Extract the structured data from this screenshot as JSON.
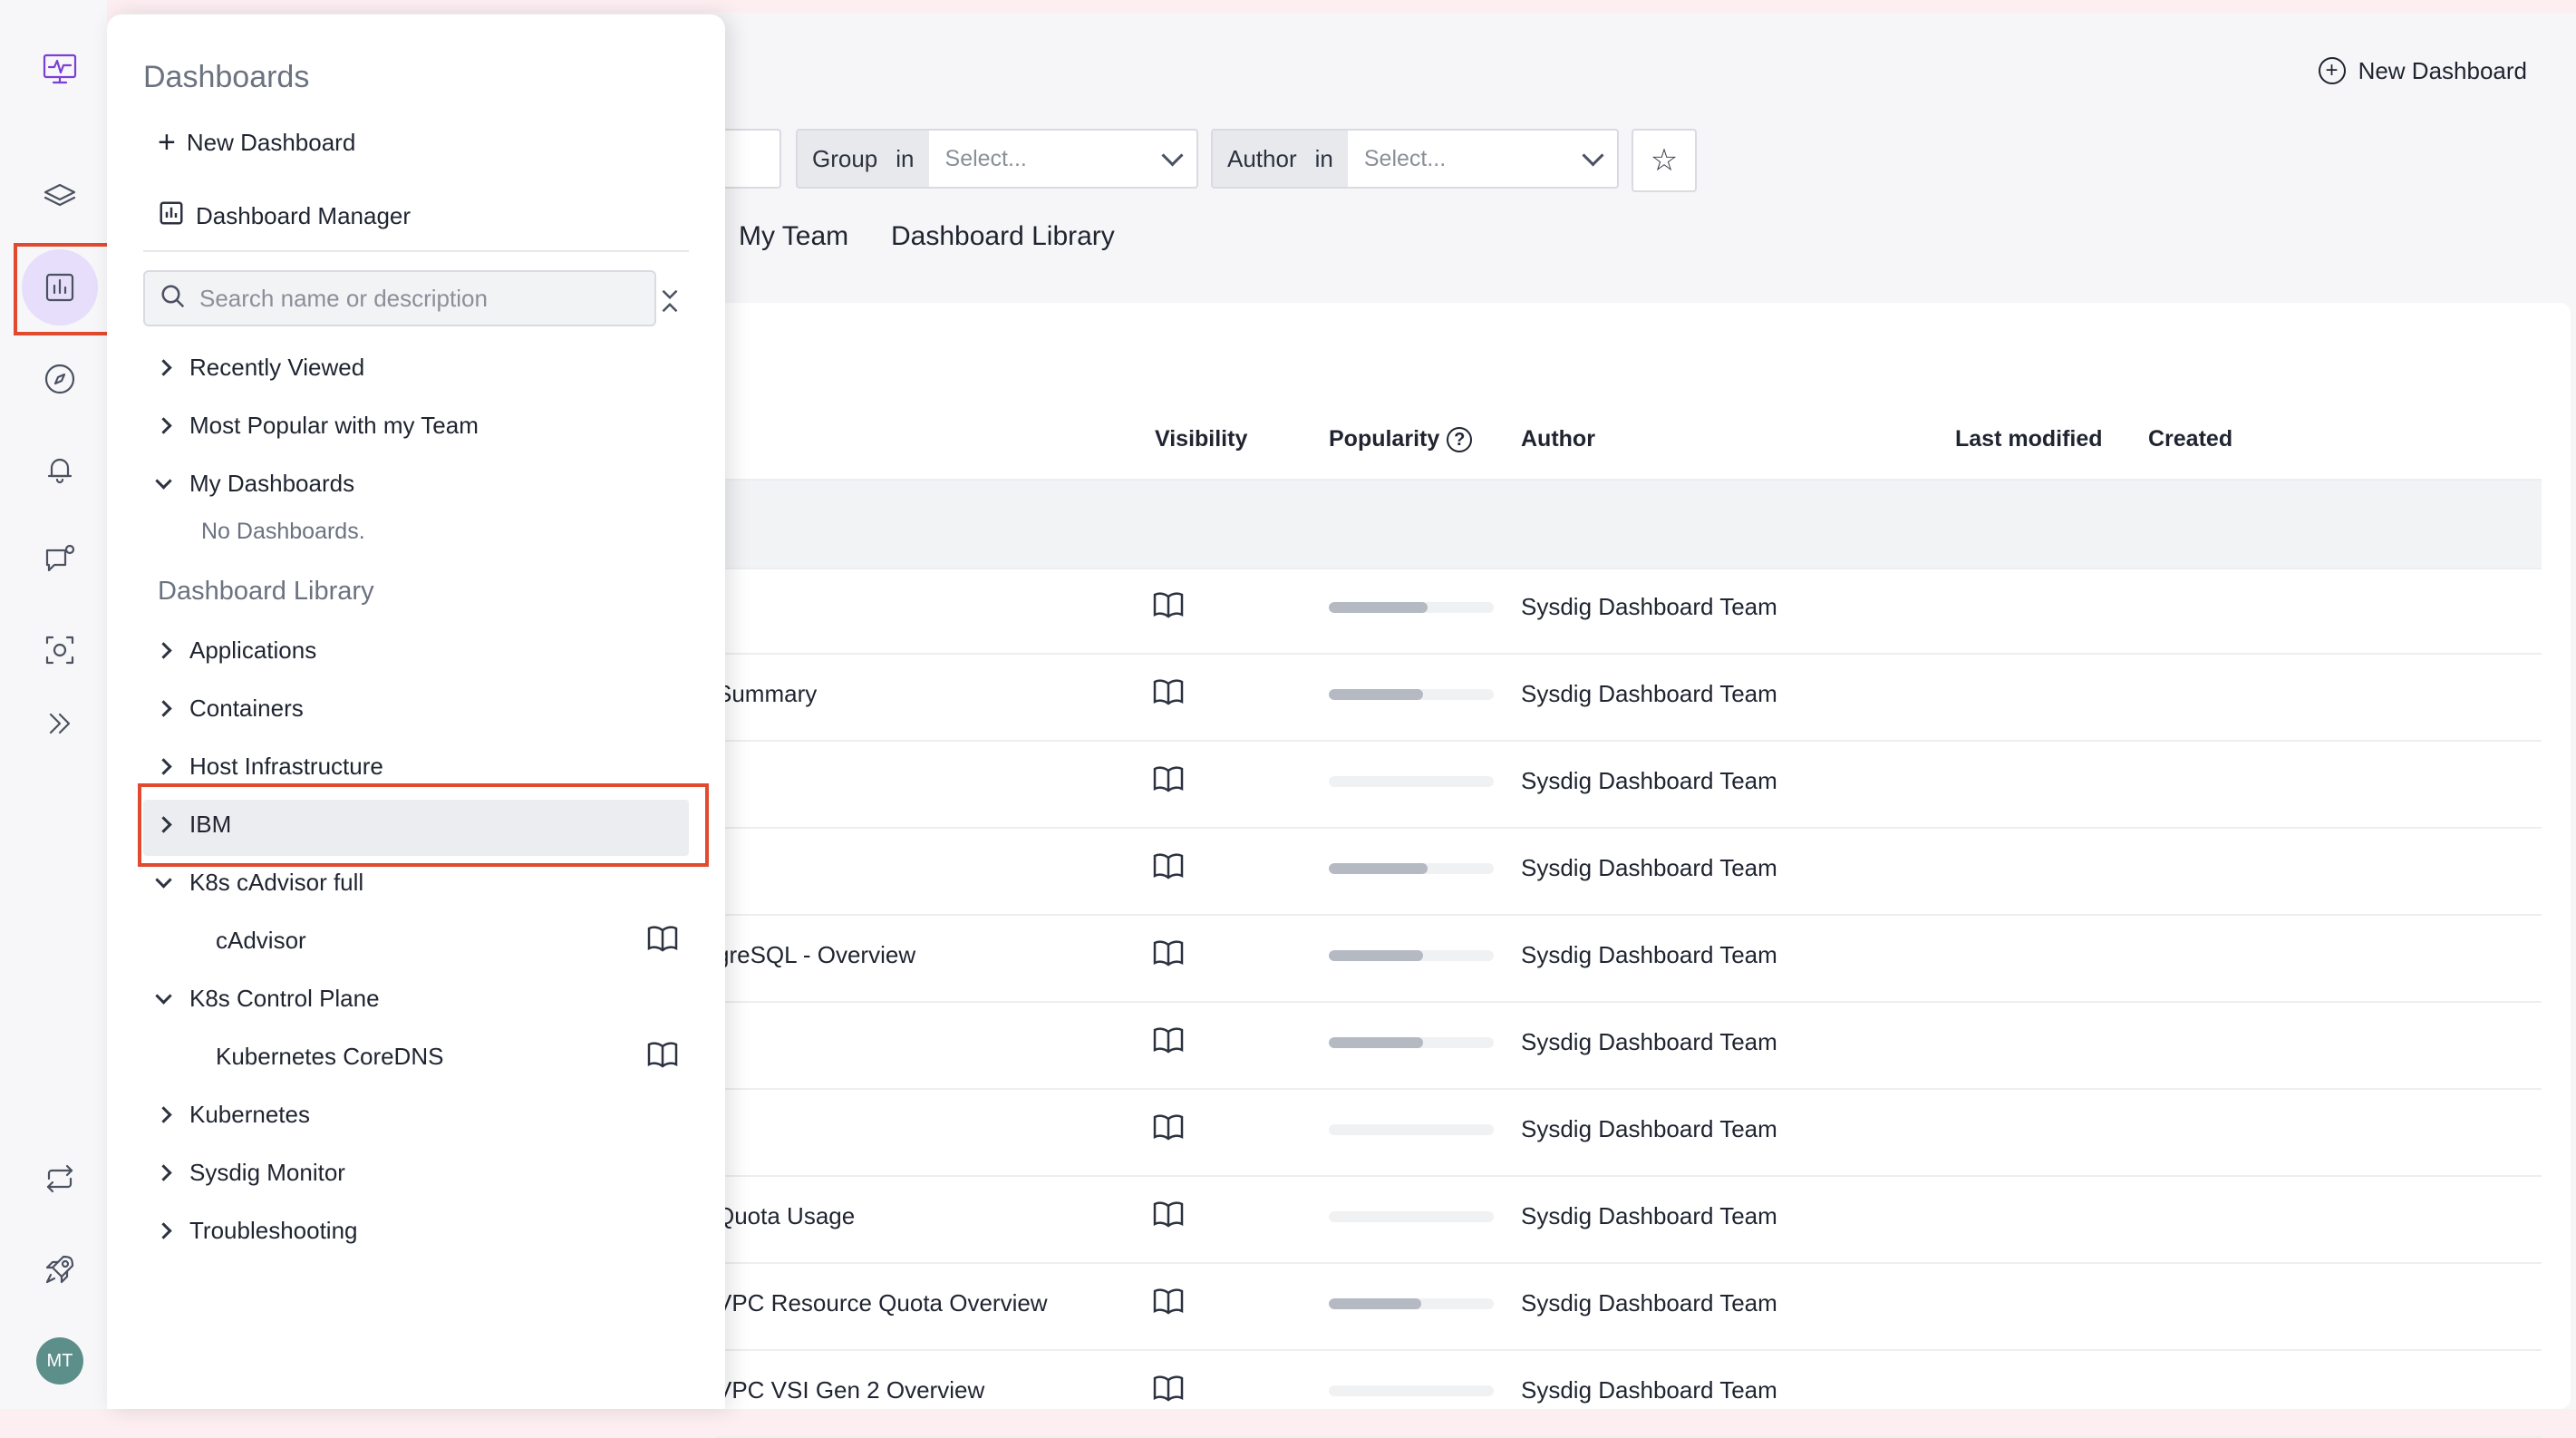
{
  "header": {
    "new_dashboard_label": "New Dashboard"
  },
  "filters": {
    "group": {
      "label": "Group",
      "op": "in",
      "placeholder": "Select..."
    },
    "author": {
      "label": "Author",
      "op": "in",
      "placeholder": "Select..."
    }
  },
  "tabs": [
    "My Team",
    "Dashboard Library"
  ],
  "table": {
    "columns": {
      "visibility": "Visibility",
      "popularity": "Popularity",
      "author": "Author",
      "last_modified": "Last modified",
      "created": "Created"
    },
    "rows": [
      {
        "name": "",
        "popularity": 0.6,
        "author": "Sysdig Dashboard Team"
      },
      {
        "name": "Summary",
        "popularity": 0.57,
        "author": "Sysdig Dashboard Team"
      },
      {
        "name": "",
        "popularity": 0.0,
        "author": "Sysdig Dashboard Team"
      },
      {
        "name": "",
        "popularity": 0.6,
        "author": "Sysdig Dashboard Team"
      },
      {
        "name": "greSQL - Overview",
        "popularity": 0.57,
        "author": "Sysdig Dashboard Team"
      },
      {
        "name": "",
        "popularity": 0.57,
        "author": "Sysdig Dashboard Team"
      },
      {
        "name": "",
        "popularity": 0.0,
        "author": "Sysdig Dashboard Team"
      },
      {
        "name": "Quota Usage",
        "popularity": 0.0,
        "author": "Sysdig Dashboard Team"
      },
      {
        "name": "VPC Resource Quota Overview",
        "popularity": 0.56,
        "author": "Sysdig Dashboard Team"
      },
      {
        "name": "VPC VSI Gen 2 Overview",
        "popularity": 0.0,
        "author": "Sysdig Dashboard Team"
      }
    ]
  },
  "panel": {
    "title": "Dashboards",
    "new_dashboard": "New Dashboard",
    "dashboard_manager": "Dashboard Manager",
    "search_placeholder": "Search name or description",
    "recently_viewed": "Recently Viewed",
    "most_popular": "Most Popular with my Team",
    "my_dashboards": "My Dashboards",
    "no_dashboards": "No Dashboards.",
    "library_heading": "Dashboard Library",
    "library": {
      "applications": "Applications",
      "containers": "Containers",
      "host_infrastructure": "Host Infrastructure",
      "ibm": "IBM",
      "k8s_cadvisor": "K8s cAdvisor full",
      "cadvisor": "cAdvisor",
      "k8s_control_plane": "K8s Control Plane",
      "coredns": "Kubernetes CoreDNS",
      "kubernetes": "Kubernetes",
      "sysdig_monitor": "Sysdig Monitor",
      "troubleshooting": "Troubleshooting"
    }
  },
  "user": {
    "initials": "MT"
  },
  "colors": {
    "accent": "#e6defa",
    "highlight": "#e04a2f"
  }
}
